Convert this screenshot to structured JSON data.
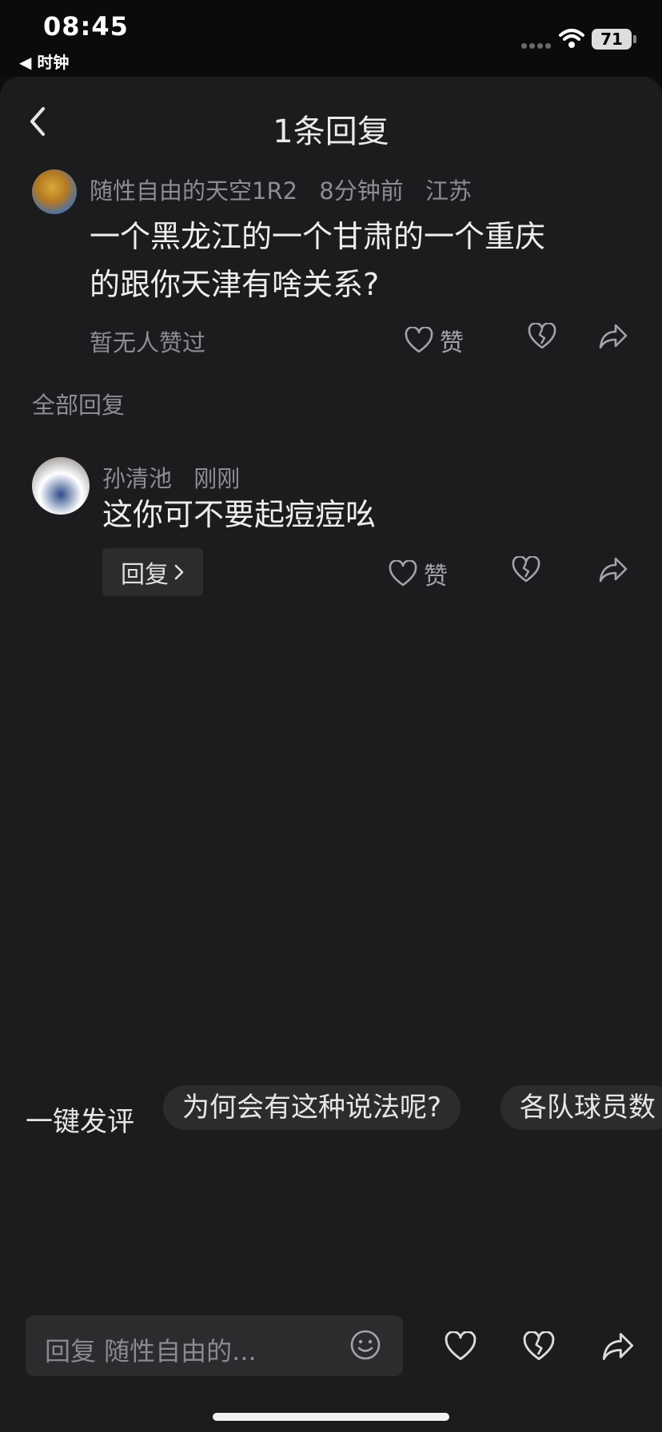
{
  "status_bar": {
    "time": "08:45",
    "back_app": "◀ 时钟",
    "battery": "71"
  },
  "header": {
    "title": "1条回复"
  },
  "main_comment": {
    "username": "随性自由的天空1R2",
    "time": "8分钟前",
    "location": "江苏",
    "text_line1": "一个黑龙江的一个甘肃的一个重庆",
    "text_line2": "的跟你天津有啥关系?",
    "likes_status": "暂无人赞过",
    "like_label": "赞"
  },
  "section": {
    "all_replies": "全部回复"
  },
  "replies": [
    {
      "username": "孙清池",
      "time": "刚刚",
      "text": "这你可不要起痘痘吆",
      "reply_button": "回复",
      "like_label": "赞"
    }
  ],
  "quick_comment": {
    "label": "一键发评",
    "chips": [
      "为何会有这种说法呢?",
      "各队球员数"
    ]
  },
  "composer": {
    "placeholder": "回复 随性自由的..."
  },
  "icons": {
    "like": "heart-icon",
    "dislike": "broken-heart-icon",
    "share": "share-arrow-icon",
    "emoji": "emoji-icon",
    "back": "chevron-left-icon"
  }
}
